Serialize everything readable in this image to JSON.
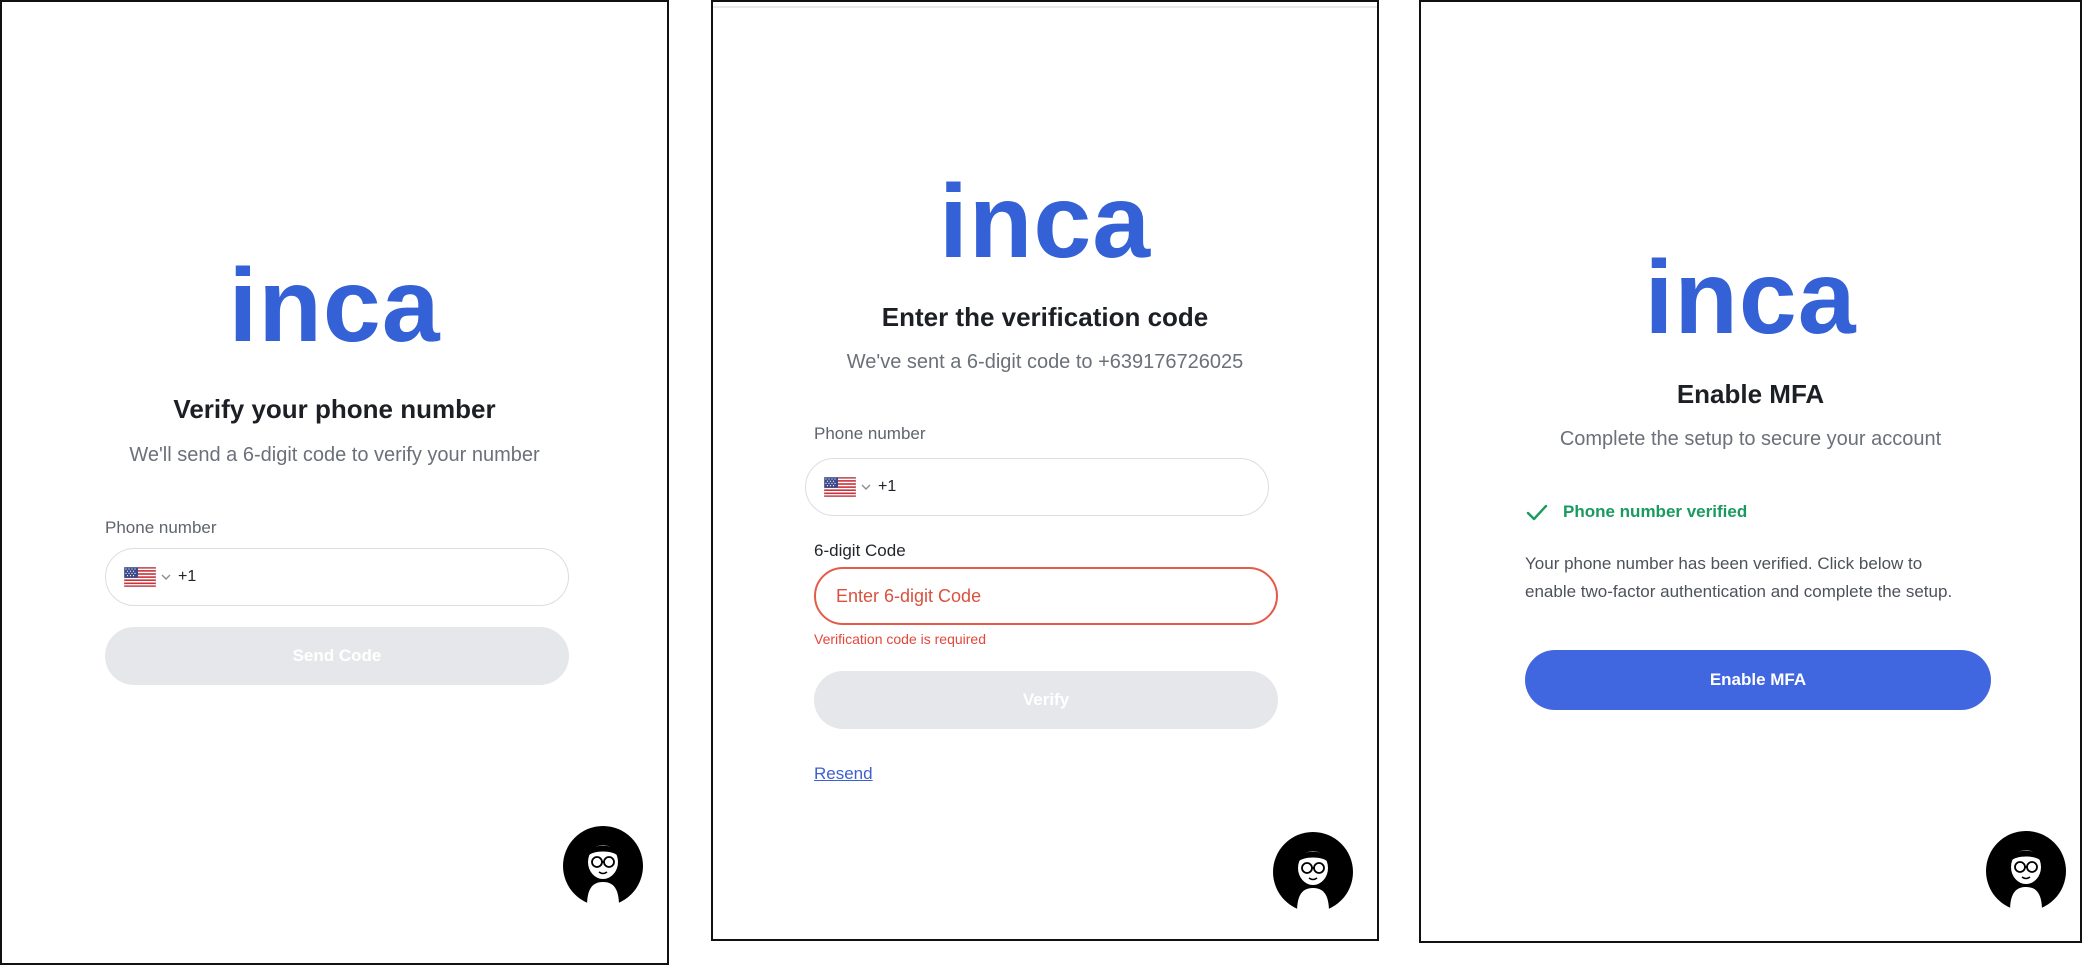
{
  "brand": {
    "logo_text": "inca",
    "color": "#3461d6"
  },
  "colors": {
    "primary": "#4167e0",
    "error": "#e2473a",
    "success": "#1a9a60",
    "disabled": "#e6e7ea"
  },
  "screen1": {
    "title": "Verify your phone number",
    "subtitle": "We'll send a 6-digit code to verify your number",
    "phone_label": "Phone number",
    "country_icon": "us-flag-icon",
    "dial_code": "+1",
    "phone_value": "",
    "send_button": "Send Code"
  },
  "screen2": {
    "title": "Enter the verification code",
    "subtitle": "We've sent a 6-digit code to +639176726025",
    "phone_label": "Phone number",
    "country_icon": "us-flag-icon",
    "dial_code": "+1",
    "phone_value": "",
    "code_label": "6-digit Code",
    "code_placeholder": "Enter 6-digit Code",
    "code_error": "Verification code is required",
    "verify_button": "Verify",
    "resend_link": "Resend"
  },
  "screen3": {
    "title": "Enable MFA",
    "subtitle": "Complete the setup to secure your account",
    "status_icon": "check-icon",
    "status_text": "Phone number verified",
    "body_line1": "Your phone number has been verified. Click below to",
    "body_line2": "enable two-factor authentication and complete the setup.",
    "enable_button": "Enable MFA"
  },
  "support": {
    "icon": "support-avatar-icon"
  }
}
